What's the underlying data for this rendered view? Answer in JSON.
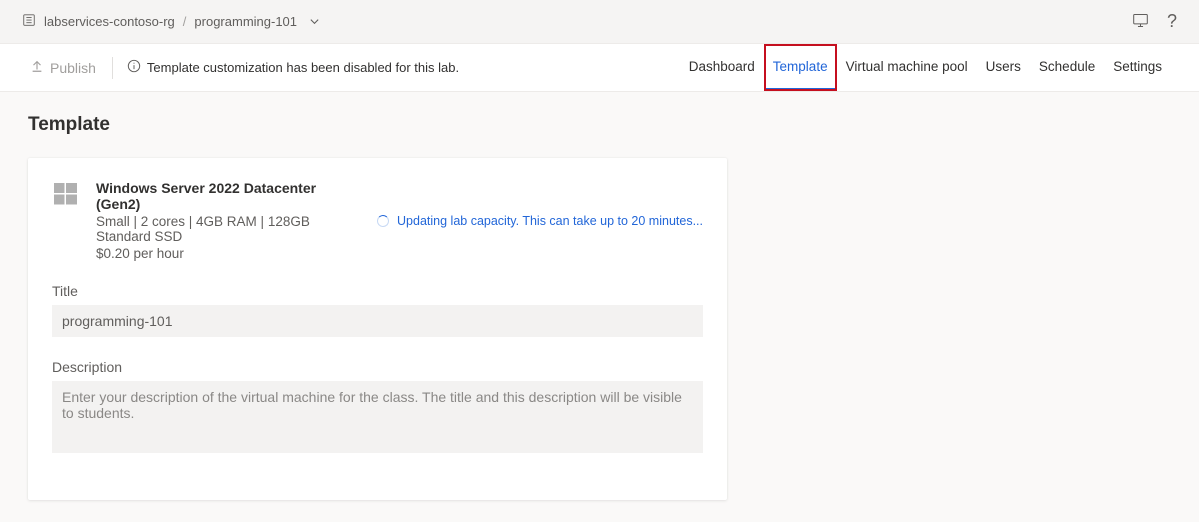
{
  "breadcrumb": {
    "resource_group": "labservices-contoso-rg",
    "separator": "/",
    "lab_name": "programming-101"
  },
  "toolbar": {
    "publish_label": "Publish",
    "info_message": "Template customization has been disabled for this lab."
  },
  "tabs": {
    "dashboard": "Dashboard",
    "template": "Template",
    "vmpool": "Virtual machine pool",
    "users": "Users",
    "schedule": "Schedule",
    "settings": "Settings"
  },
  "page": {
    "title": "Template"
  },
  "template_card": {
    "vm_name": "Windows Server 2022 Datacenter (Gen2)",
    "vm_spec": "Small | 2 cores | 4GB RAM | 128GB Standard SSD",
    "vm_cost": "$0.20 per hour",
    "status_message": "Updating lab capacity. This can take up to 20 minutes...",
    "title_label": "Title",
    "title_value": "programming-101",
    "description_label": "Description",
    "description_placeholder": "Enter your description of the virtual machine for the class. The title and this description will be visible to students.",
    "description_value": ""
  }
}
